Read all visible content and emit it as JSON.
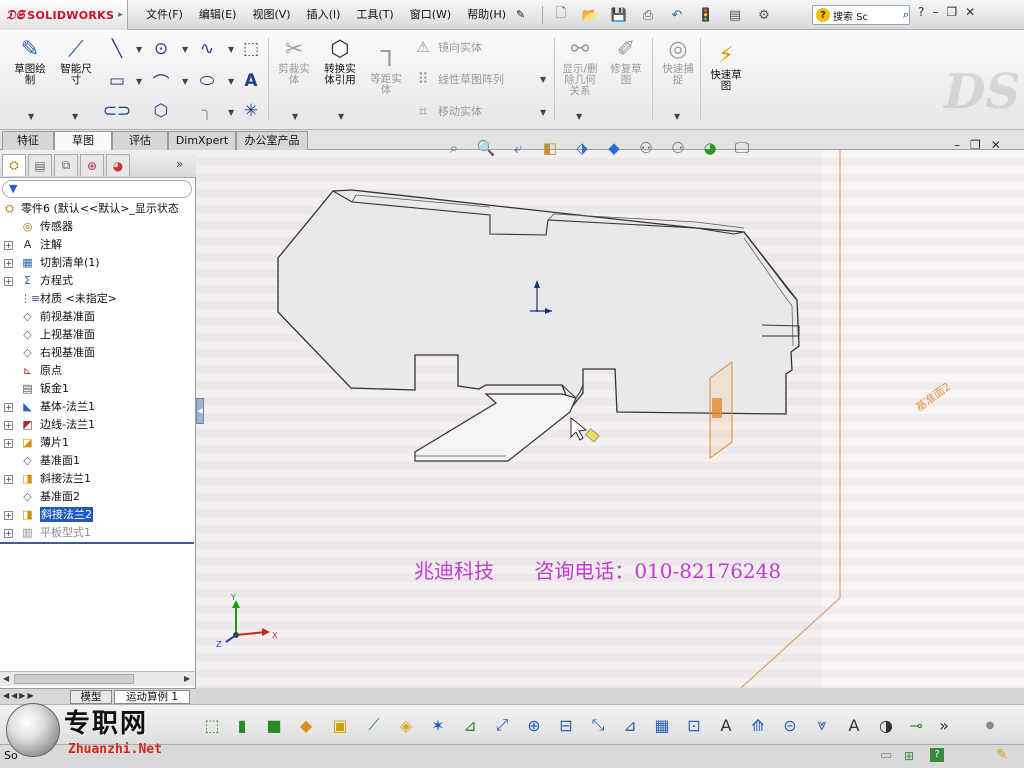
{
  "app": {
    "name": "SOLIDWORKS",
    "menus": [
      "文件(F)",
      "编辑(E)",
      "视图(V)",
      "插入(I)",
      "工具(T)",
      "窗口(W)",
      "帮助(H)"
    ],
    "search_placeholder": "搜索 Sc"
  },
  "command_manager": {
    "sketch": "草图绘\n制",
    "smart_dim": "智能尺\n寸",
    "trim": "剪裁实\n体",
    "convert": "转换实\n体引用",
    "offset": "等距实\n体",
    "mirror": "镜向实体",
    "linear_pattern": "线性草图阵列",
    "move": "移动实体",
    "relations": "显示/删\n除几何\n关系",
    "repair": "修复草\n图",
    "snap": "快速捕\n捉",
    "rapid": "快速草\n图"
  },
  "tabs": [
    "特征",
    "草图",
    "评估",
    "DimXpert",
    "办公室产品"
  ],
  "active_tab": "草图",
  "tree": {
    "root": "零件6  (默认<<默认>_显示状态",
    "items": [
      {
        "label": "传感器",
        "icon": "sensor-icon",
        "expand": false
      },
      {
        "label": "注解",
        "icon": "annotation-icon",
        "expand": true
      },
      {
        "label": "切割清单(1)",
        "icon": "cutlist-icon",
        "expand": true
      },
      {
        "label": "方程式",
        "icon": "equation-icon",
        "expand": true
      },
      {
        "label": "材质 <未指定>",
        "icon": "material-icon",
        "expand": false
      },
      {
        "label": "前视基准面",
        "icon": "plane-icon",
        "expand": false
      },
      {
        "label": "上视基准面",
        "icon": "plane-icon",
        "expand": false
      },
      {
        "label": "右视基准面",
        "icon": "plane-icon",
        "expand": false
      },
      {
        "label": "原点",
        "icon": "origin-icon",
        "expand": false
      },
      {
        "label": "钣金1",
        "icon": "sheetmetal-icon",
        "expand": false
      },
      {
        "label": "基体-法兰1",
        "icon": "baseflange-icon",
        "expand": true
      },
      {
        "label": "边线-法兰1",
        "icon": "edgeflange-icon",
        "expand": true
      },
      {
        "label": "薄片1",
        "icon": "tab-icon",
        "expand": true
      },
      {
        "label": "基准面1",
        "icon": "plane-icon",
        "expand": false
      },
      {
        "label": "斜接法兰1",
        "icon": "miterflange-icon",
        "expand": true
      },
      {
        "label": "基准面2",
        "icon": "plane-icon",
        "expand": false
      },
      {
        "label": "斜接法兰2",
        "icon": "miterflange-icon",
        "expand": true,
        "selected": true
      },
      {
        "label": "平板型式1",
        "icon": "flatpattern-icon",
        "expand": true,
        "grey": true
      }
    ]
  },
  "bottom_tabs": [
    "模型",
    "运动算例 1"
  ],
  "graphics": {
    "plane_label": "基准面2",
    "watermark_company": "兆迪科技",
    "watermark_phone": "咨询电话：010-82176248"
  },
  "brand": {
    "cn": "专职网",
    "en": "Zhuanzhi.Net"
  },
  "status": {
    "left": "So"
  },
  "colors": {
    "brand_red": "#c8102e",
    "selection_blue": "#1e58c4",
    "watermark_magenta": "#c23bd2",
    "plane_orange": "#e58a2e"
  }
}
